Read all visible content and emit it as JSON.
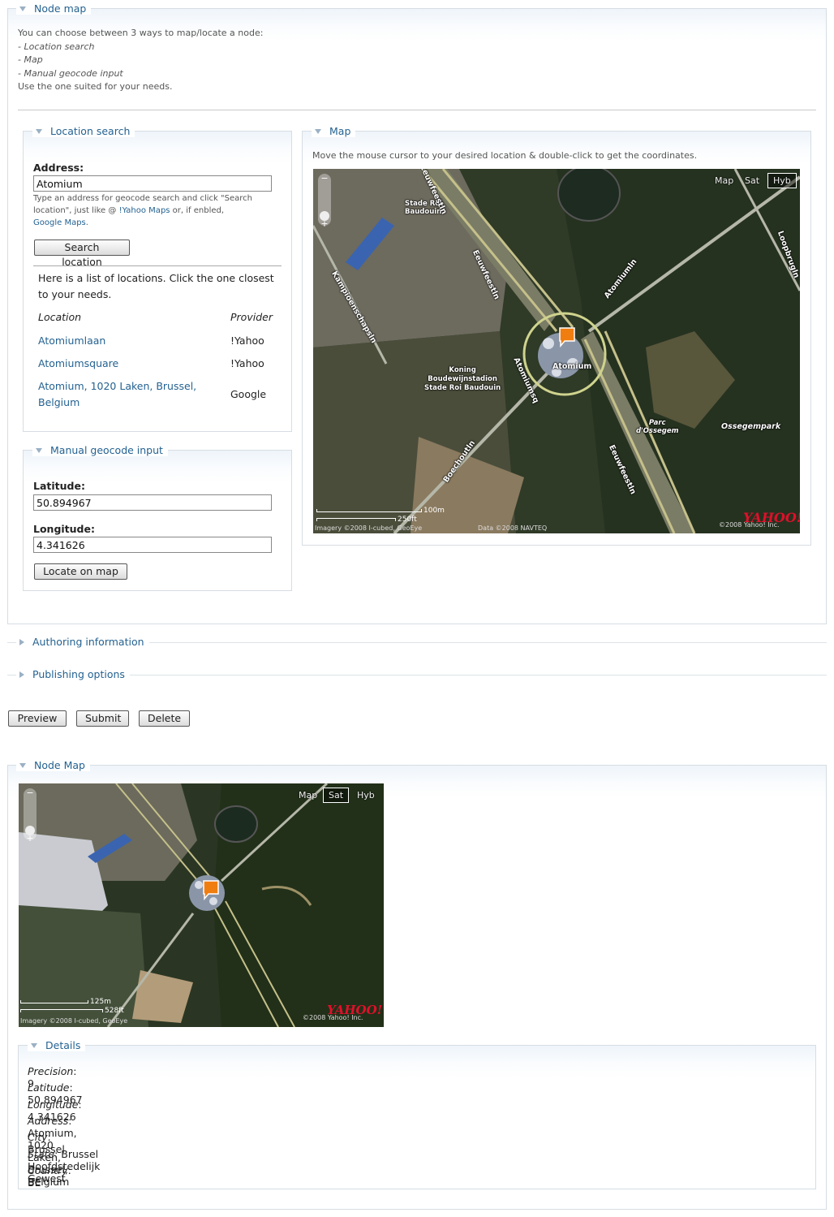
{
  "node_map_section": {
    "title": "Node map",
    "intro": [
      "You can choose between 3 ways to map/locate a node:",
      "- Location search",
      "- Map",
      "- Manual geocode input",
      "Use the one suited for your needs."
    ]
  },
  "location_search": {
    "title": "Location search",
    "address_label": "Address:",
    "address_value": "Atomium",
    "help_prefix": "Type an address for geocode search and click \"Search location\", just like @ ",
    "help_link_yahoo": "!Yahoo Maps",
    "help_middle": " or, if enbled,",
    "help_link_google": "Google Maps",
    "help_suffix": ".",
    "search_button": "Search location",
    "results_intro": "Here is a list of locations. Click the one closest to your needs.",
    "col_location": "Location",
    "col_provider": "Provider",
    "results": [
      {
        "location": "Atomiumlaan",
        "provider": "!Yahoo"
      },
      {
        "location": "Atomiumsquare",
        "provider": "!Yahoo"
      },
      {
        "location": "Atomium, 1020 Laken, Brussel, Belgium",
        "provider": "Google"
      }
    ]
  },
  "manual_geocode": {
    "title": "Manual geocode input",
    "latitude_label": "Latitude:",
    "latitude_value": "50.894967",
    "longitude_label": "Longitude:",
    "longitude_value": "4.341626",
    "locate_button": "Locate on map"
  },
  "map_panel": {
    "title": "Map",
    "instruction": "Move the mouse cursor to your desired location & double-click to get the coordinates.",
    "type_buttons": [
      "Map",
      "Sat",
      "Hyb"
    ],
    "selected_type": "Hyb",
    "zoom_minus": "−",
    "zoom_plus": "+",
    "labels": {
      "stade_roi": "Stade Roi\nBaudouin",
      "eeuwfeest_top": "Eeuwfeestln",
      "eeuwfeest_mid": "Eeuwfeestln",
      "eeuwfeest_bottom": "Eeuwfeestln",
      "kampioen": "Kampioenschapsln",
      "atomiumln": "Atomiumln",
      "loopbrug": "Loopbrugln",
      "atomium": "Atomium",
      "atomiumsq": "Atomiumsq",
      "koning": "Koning\nBoudewijnstadion\nStade Roi Baudouin",
      "boechoutln": "Boechoutln",
      "parc": "Parc\nd'Ossegem",
      "ossegempark": "Ossegempark"
    },
    "scale_m": "100m",
    "scale_ft": "250ft",
    "copyright_imagery": "Imagery ©2008 I-cubed, GeoEye",
    "copyright_data": "Data ©2008 NAVTEQ",
    "copyright_yahoo": "©2008 Yahoo! Inc.",
    "logo": "YAHOO!"
  },
  "collapsed_sections": {
    "authoring": "Authoring information",
    "publishing": "Publishing options"
  },
  "actions": {
    "preview": "Preview",
    "submit": "Submit",
    "delete": "Delete"
  },
  "node_map_view": {
    "title": "Node Map",
    "type_buttons": [
      "Map",
      "Sat",
      "Hyb"
    ],
    "selected_type": "Sat",
    "scale_m": "125m",
    "scale_ft": "528ft",
    "copyright_imagery": "Imagery ©2008 I-cubed, GeoEye",
    "copyright_yahoo": "©2008 Yahoo! Inc.",
    "logo": "YAHOO!"
  },
  "details": {
    "title": "Details",
    "rows": [
      {
        "label": "Precision",
        "value": "9"
      },
      {
        "label": "Latitude",
        "value": "50.894967"
      },
      {
        "label": "Longitude",
        "value": "4.341626"
      },
      {
        "label": "Address",
        "value": "Atomium, 1020 Laken, Brussel, Belgium"
      },
      {
        "label": "City",
        "value": "Brussel"
      },
      {
        "label": "State",
        "value": "Brussel Hoofdstedelijk Gewest"
      },
      {
        "label": "Country",
        "value": "BE"
      }
    ]
  },
  "colors": {
    "link": "#246291",
    "marker": "#f07d10",
    "legend_triangle": "#9ab0c4"
  }
}
